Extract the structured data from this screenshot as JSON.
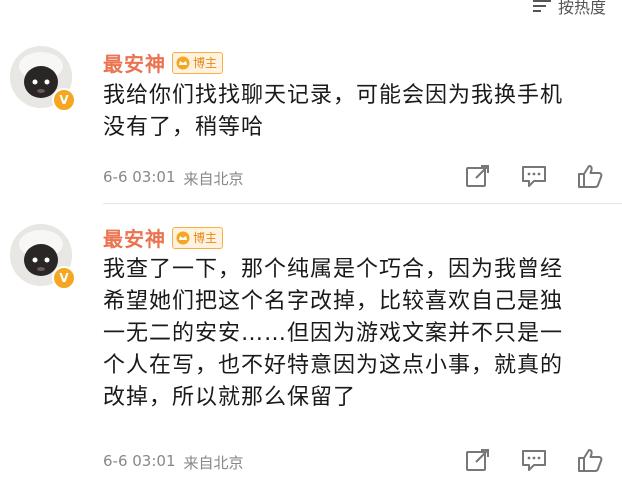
{
  "header": {
    "sort_label": "按热度"
  },
  "comments": [
    {
      "username": "最安神",
      "badge": "博主",
      "text": "我给你们找找聊天记录，可能会因为我换手机\n没有了，稍等哈",
      "time": "6-6 03:01",
      "location": "来自北京"
    },
    {
      "username": "最安神",
      "badge": "博主",
      "text": "我查了一下，那个纯属是个巧合，因为我曾经\n希望她们把这个名字改掉，比较喜欢自己是独\n一无二的安安……但因为游戏文案并不只是一\n个人在写，也不好特意因为这点小事，就真的\n改掉，所以就那么保留了",
      "time": "6-6 03:01",
      "location": "来自北京"
    }
  ],
  "icons": {
    "sort": "sort-icon",
    "share": "share-icon",
    "comment": "comment-icon",
    "like": "like-icon",
    "verified": "verified-badge-icon",
    "crown": "crown-icon"
  },
  "colors": {
    "username": "#eb7350",
    "badge": "#f5a623",
    "meta": "#888888"
  }
}
